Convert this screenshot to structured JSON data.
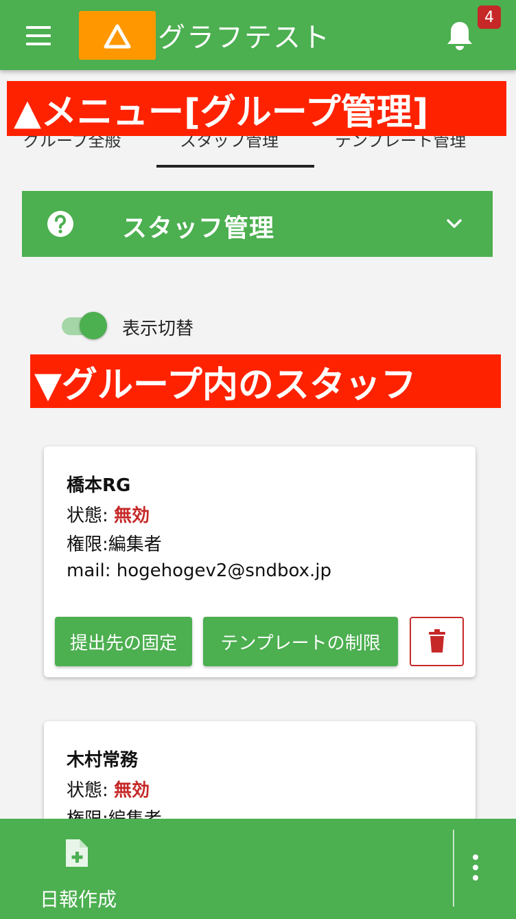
{
  "header": {
    "title": "グラフテスト",
    "notification_count": "4",
    "icons": {
      "menu": "menu-icon",
      "logo": "warning-triangle-icon",
      "bell": "bell-icon"
    }
  },
  "annotations": {
    "top": "▲メニュー[グループ管理]",
    "middle": "▼グループ内のスタッフ",
    "color": "#ff2200"
  },
  "tabs": [
    {
      "label": "グループ全般"
    },
    {
      "label": "スタッフ管理"
    },
    {
      "label": "テンプレート管理"
    }
  ],
  "section": {
    "title": "スタッフ管理",
    "icons": {
      "help": "help-circle-icon",
      "expand": "chevron-down-icon"
    }
  },
  "toggle": {
    "label": "表示切替",
    "on": true
  },
  "staff": [
    {
      "name": "橋本RG",
      "status_label": "状態: ",
      "status_value": "無効",
      "role": "権限:編集者",
      "mail": "mail: hogehogev2@sndbox.jp",
      "buttons": {
        "fix": "提出先の固定",
        "template": "テンプレートの制限"
      }
    },
    {
      "name": "木村常務",
      "status_label": "状態: ",
      "status_value": "無効",
      "role": "権限:編集者"
    }
  ],
  "bottom": {
    "report_label": "日報作成",
    "icons": {
      "report": "file-plus-icon",
      "more": "more-vertical-icon"
    }
  },
  "colors": {
    "primary": "#4caf50",
    "accent": "#ff9800",
    "danger": "#c62828",
    "background": "#f3f3f3"
  }
}
